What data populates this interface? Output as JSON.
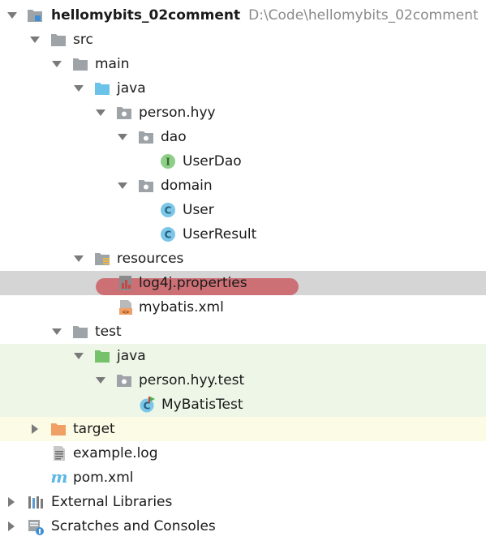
{
  "project": {
    "name": "hellomybits_02comment",
    "path": "D:\\Code\\hellomybits_02comment"
  },
  "tree": {
    "src": "src",
    "main": "main",
    "java_main": "java",
    "person_hyy": "person.hyy",
    "dao": "dao",
    "user_dao": "UserDao",
    "domain": "domain",
    "user": "User",
    "user_result": "UserResult",
    "resources": "resources",
    "log4j": "log4j.properties",
    "mybatis": "mybatis.xml",
    "test": "test",
    "java_test": "java",
    "person_hyy_test": "person.hyy.test",
    "mybatis_test": "MyBatisTest",
    "target": "target",
    "example_log": "example.log",
    "pom": "pom.xml",
    "external_libraries": "External Libraries",
    "scratches": "Scratches and Consoles"
  },
  "icons": {
    "interface_badge": "I",
    "class_badge": "C",
    "maven_badge": "m",
    "xml_badge": "<>"
  },
  "colors": {
    "selection": "#d5d5d5",
    "test_bg": "#edf6e7",
    "excluded_bg": "#fbfbe6",
    "annotation_highlight": "#c94a52",
    "folder_gray": "#9ea3a8",
    "source_blue": "#6cc3ea",
    "test_green": "#76c26a",
    "excluded_orange": "#f0a064",
    "interface_green": "#8fcf8a",
    "class_blue": "#7cc6e8"
  }
}
